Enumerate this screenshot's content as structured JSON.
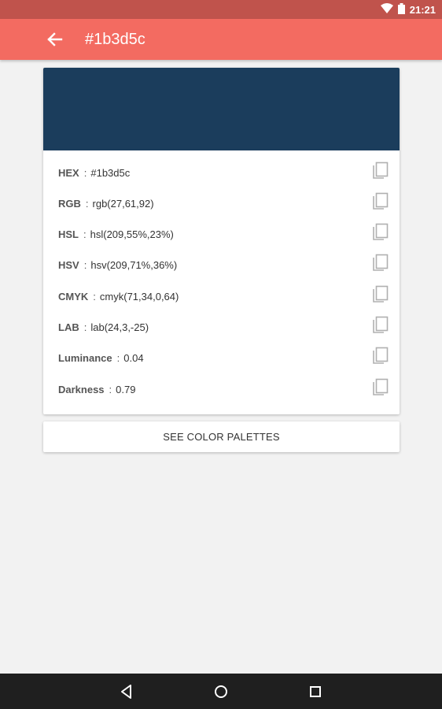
{
  "status_bar": {
    "time": "21:21",
    "icons": [
      "wifi-icon",
      "battery-icon"
    ]
  },
  "app_bar": {
    "title": "#1b3d5c",
    "back_icon": "arrow-back-icon"
  },
  "swatch": {
    "color": "#1b3d5c"
  },
  "properties": [
    {
      "label": "HEX",
      "value": "#1b3d5c"
    },
    {
      "label": "RGB",
      "value": "rgb(27,61,92)"
    },
    {
      "label": "HSL",
      "value": "hsl(209,55%,23%)"
    },
    {
      "label": "HSV",
      "value": "hsv(209,71%,36%)"
    },
    {
      "label": "CMYK",
      "value": "cmyk(71,34,0,64)"
    },
    {
      "label": "LAB",
      "value": "lab(24,3,-25)"
    },
    {
      "label": "Luminance",
      "value": "0.04"
    },
    {
      "label": "Darkness",
      "value": "0.79"
    }
  ],
  "separator": ":",
  "palette_button": {
    "label": "SEE COLOR PALETTES"
  },
  "nav_bar": {
    "icons": [
      "back-triangle-icon",
      "home-circle-icon",
      "recents-square-icon"
    ]
  },
  "colors": {
    "status_bar": "#c0534c",
    "app_bar": "#f36b61",
    "background": "#f2f2f2",
    "nav_bar": "#1f1f1f"
  }
}
